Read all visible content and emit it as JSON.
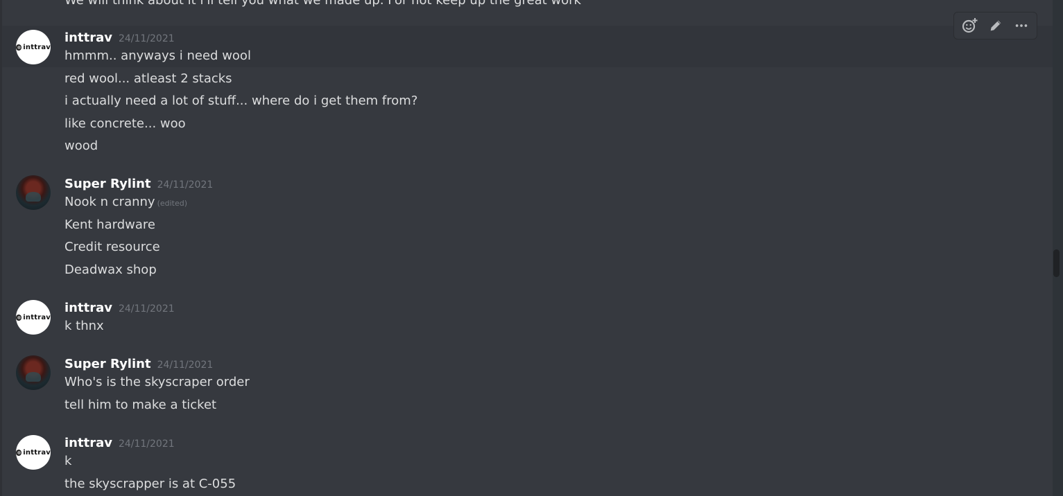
{
  "cut_message": "We will think about it i'll tell you what we made up. For not keep up the great work",
  "toolbar": {
    "add_reaction_icon": "add-reaction-icon",
    "edit_icon": "edit-icon",
    "more_icon": "more-icon"
  },
  "groups": [
    {
      "author": "inttrav",
      "avatar_text": "inttrav",
      "timestamp": "24/11/2021",
      "messages": [
        {
          "text": "hmmm.. anyways i need wool"
        },
        {
          "text": "red wool... atleast 2 stacks"
        },
        {
          "text": "i actually need a lot of stuff... where do i get them from?"
        },
        {
          "text": "like concrete... woo"
        },
        {
          "text": "wood"
        }
      ]
    },
    {
      "author": "Super Rylint",
      "timestamp": "24/11/2021",
      "messages": [
        {
          "text": "Nook n cranny",
          "edited": "(edited)"
        },
        {
          "text": "Kent hardware"
        },
        {
          "text": "Credit resource"
        },
        {
          "text": "Deadwax shop"
        }
      ]
    },
    {
      "author": "inttrav",
      "avatar_text": "inttrav",
      "timestamp": "24/11/2021",
      "messages": [
        {
          "text": "k thnx"
        }
      ]
    },
    {
      "author": "Super Rylint",
      "timestamp": "24/11/2021",
      "messages": [
        {
          "text": "Who's is the skyscraper order"
        },
        {
          "text": "tell him to make a ticket"
        }
      ]
    },
    {
      "author": "inttrav",
      "avatar_text": "inttrav",
      "timestamp": "24/11/2021",
      "messages": [
        {
          "text": "k"
        },
        {
          "text": "the skyscrapper is at  C-055"
        }
      ]
    }
  ],
  "colors": {
    "background": "#36393f",
    "text": "#dcddde",
    "username": "#ffffff",
    "timestamp": "#72767d"
  }
}
